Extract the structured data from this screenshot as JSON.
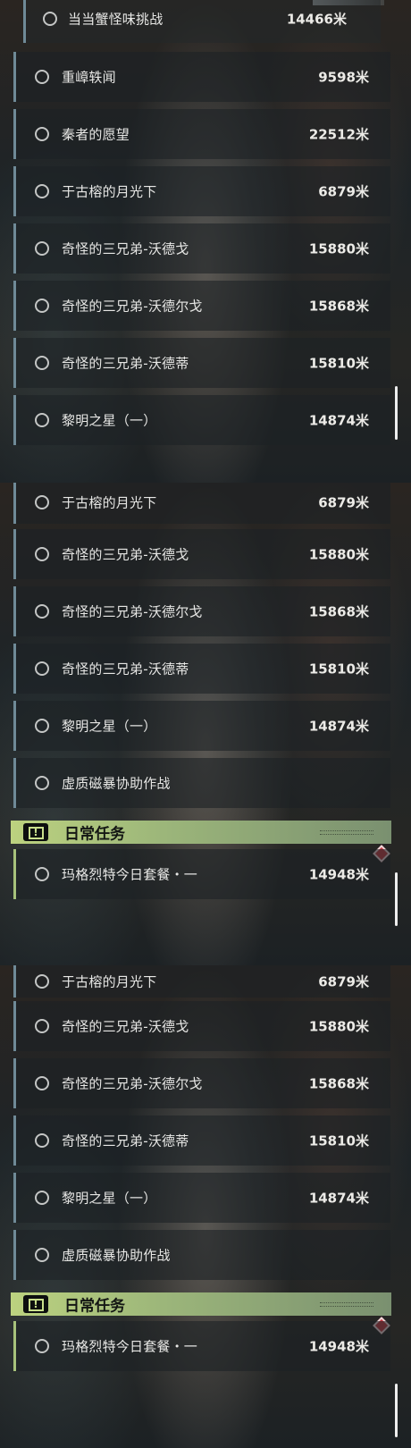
{
  "panel1": {
    "partial_row": {
      "title": "当当蟹怪味挑战",
      "distance": "14466米"
    },
    "rows": [
      {
        "title": "重嶂轶闻",
        "distance": "9598米"
      },
      {
        "title": "秦者的愿望",
        "distance": "22512米"
      },
      {
        "title": "于古榕的月光下",
        "distance": "6879米"
      },
      {
        "title": "奇怪的三兄弟-沃德戈",
        "distance": "15880米"
      },
      {
        "title": "奇怪的三兄弟-沃德尔戈",
        "distance": "15868米"
      },
      {
        "title": "奇怪的三兄弟-沃德蒂",
        "distance": "15810米"
      },
      {
        "title": "黎明之星（一）",
        "distance": "14874米"
      }
    ]
  },
  "panel2": {
    "rows": [
      {
        "title": "于古榕的月光下",
        "distance": "6879米"
      },
      {
        "title": "奇怪的三兄弟-沃德戈",
        "distance": "15880米"
      },
      {
        "title": "奇怪的三兄弟-沃德尔戈",
        "distance": "15868米"
      },
      {
        "title": "奇怪的三兄弟-沃德蒂",
        "distance": "15810米"
      },
      {
        "title": "黎明之星（一）",
        "distance": "14874米"
      },
      {
        "title": "虚质磁暴协助作战",
        "distance": ""
      }
    ],
    "section": {
      "label": "日常任务",
      "icon": "alert-icon"
    },
    "daily_rows": [
      {
        "title": "玛格烈特今日套餐・一",
        "distance": "14948米"
      }
    ]
  },
  "panel3": {
    "rows": [
      {
        "title": "于古榕的月光下",
        "distance": "6879米"
      },
      {
        "title": "奇怪的三兄弟-沃德戈",
        "distance": "15880米"
      },
      {
        "title": "奇怪的三兄弟-沃德尔戈",
        "distance": "15868米"
      },
      {
        "title": "奇怪的三兄弟-沃德蒂",
        "distance": "15810米"
      },
      {
        "title": "黎明之星（一）",
        "distance": "14874米"
      },
      {
        "title": "虚质磁暴协助作战",
        "distance": ""
      }
    ],
    "section": {
      "label": "日常任务",
      "icon": "alert-icon"
    },
    "daily_rows": [
      {
        "title": "玛格烈特今日套餐・一",
        "distance": "14948米"
      }
    ]
  },
  "colors": {
    "row_bar": "#6f8a97",
    "daily_bar": "#a7c27b",
    "section_header": "#bcd27f",
    "diamond": "#c63c45"
  }
}
